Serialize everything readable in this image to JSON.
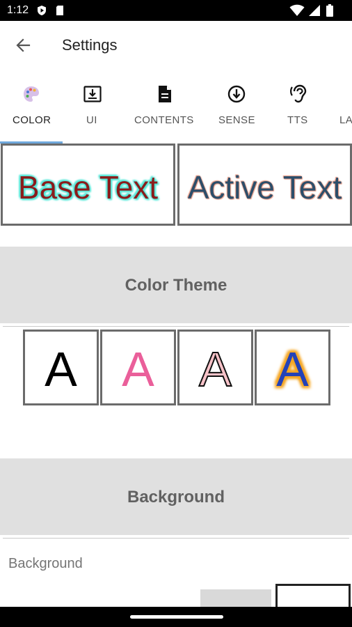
{
  "status_bar": {
    "time": "1:12",
    "icons": [
      "play-protect-icon",
      "sd-card-icon",
      "wifi-icon",
      "signal-icon",
      "battery-icon"
    ]
  },
  "app_bar": {
    "back_icon": "arrow-back-icon",
    "title": "Settings"
  },
  "tabs": [
    {
      "label": "COLOR",
      "icon": "palette-icon",
      "active": true
    },
    {
      "label": "UI",
      "icon": "download-box-icon",
      "active": false
    },
    {
      "label": "CONTENTS",
      "icon": "document-icon",
      "active": false
    },
    {
      "label": "SENSE",
      "icon": "arrow-circle-down-icon",
      "active": false
    },
    {
      "label": "TTS",
      "icon": "ear-icon",
      "active": false
    },
    {
      "label": "LA",
      "icon": "",
      "active": false
    }
  ],
  "preview": {
    "base_text": "Base Text",
    "active_text": "Active Text"
  },
  "colors": {
    "tab_indicator": "#6fa8dc",
    "base_text": "#8b1c1c",
    "base_text_glow": "#52e6d6",
    "active_text": "#2d4e6a",
    "active_text_outline": "#e79b86",
    "section_bg": "#e0e0e0",
    "theme_pink": "#ea5f9a",
    "theme_light_pink": "#f7c2c8",
    "theme_blue": "#2442b8",
    "theme_orange": "#f5a623"
  },
  "sections": {
    "color_theme": "Color Theme",
    "background": "Background"
  },
  "theme_options": [
    "A",
    "A",
    "A",
    "A"
  ],
  "background_label": "Background"
}
